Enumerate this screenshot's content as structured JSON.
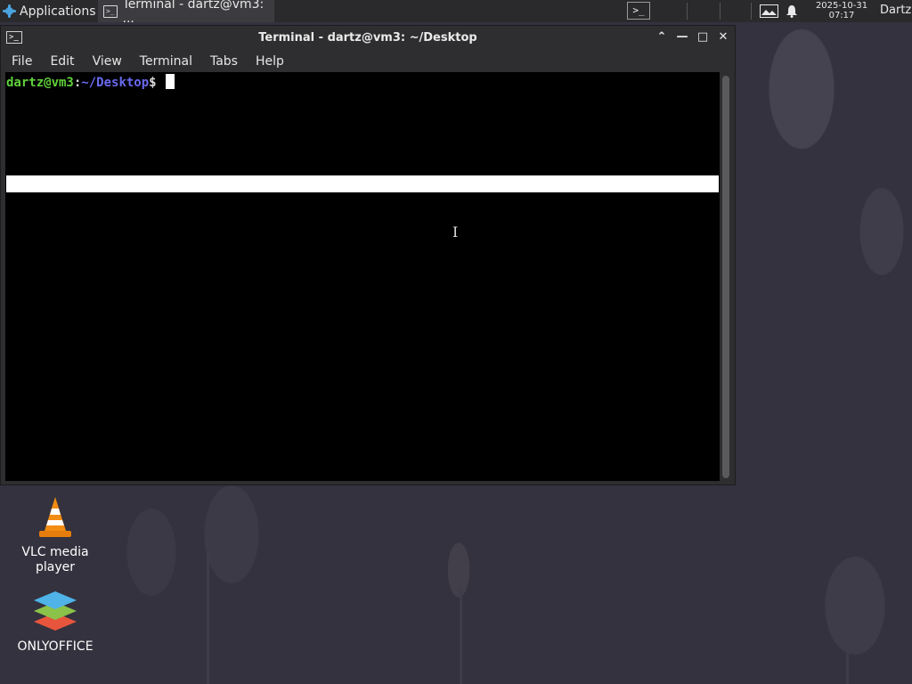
{
  "panel": {
    "applications_label": "Applications",
    "applications_menu_glyph": "≡",
    "task_title": "Terminal - dartz@vm3: ...",
    "clock_date": "2025-10-31",
    "clock_time": "07:17",
    "user": "Dartz"
  },
  "window": {
    "title": "Terminal - dartz@vm3: ~/Desktop",
    "menus": [
      "File",
      "Edit",
      "View",
      "Terminal",
      "Tabs",
      "Help"
    ]
  },
  "terminal": {
    "prompt_user_host": "dartz@vm3",
    "prompt_colon": ":",
    "prompt_path": "~/Desktop",
    "prompt_symbol": "$"
  },
  "desktop": {
    "icons": [
      {
        "label": "VLC media player",
        "icon": "vlc-cone-icon"
      },
      {
        "label": "ONLYOFFICE",
        "icon": "onlyoffice-stack-icon"
      }
    ]
  }
}
